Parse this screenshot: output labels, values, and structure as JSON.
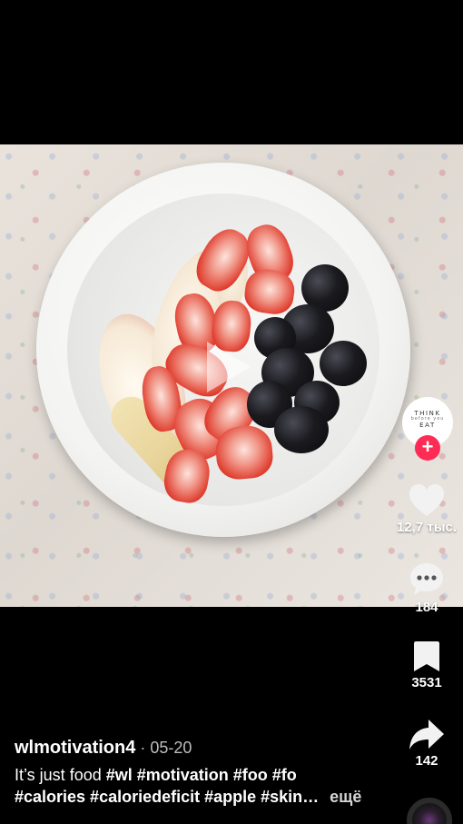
{
  "video": {
    "image": "bowl of sliced apples, strawberries and blackberries on floral fabric"
  },
  "creator_avatar": {
    "line1": "THINK",
    "line2": "before you",
    "line3": "EAT"
  },
  "follow_button": {
    "label": "+"
  },
  "actions": {
    "likes": "12,7 тыс.",
    "comments": "184",
    "saves": "3531",
    "shares": "142"
  },
  "post": {
    "author": "wlmotivation4",
    "separator": " · ",
    "date": "05-20",
    "text_prefix": "It’s just food",
    "hashtags_line1": "#wl #motivation #foo #fo",
    "hashtags_line2": "#calories #caloriedeficit #apple #skin…",
    "more_label": "ещё"
  },
  "colors": {
    "follow": "#fe2c55",
    "background": "#000000"
  }
}
